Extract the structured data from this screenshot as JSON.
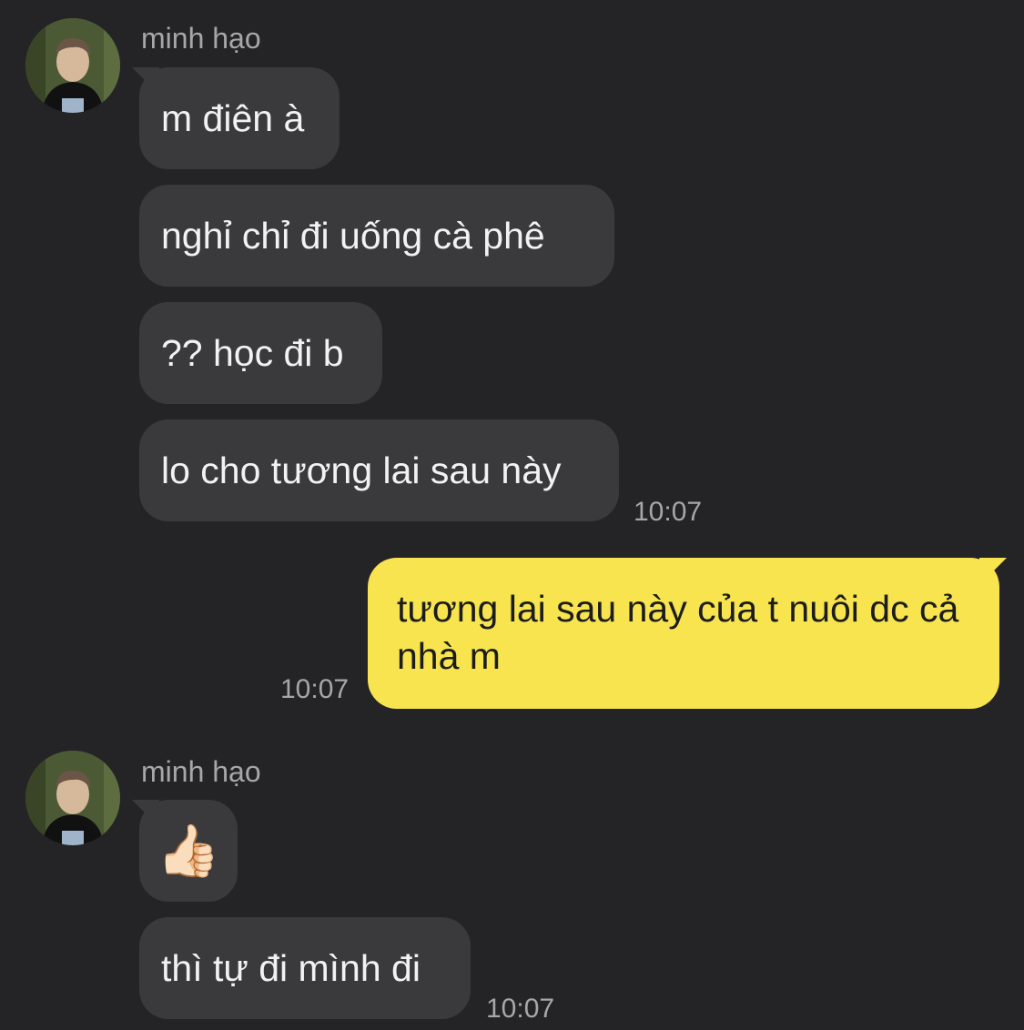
{
  "colors": {
    "background": "#242426",
    "incoming_bubble": "#3a3a3d",
    "outgoing_bubble": "#f7e44e",
    "timestamp": "#a7a7aa"
  },
  "groups": [
    {
      "sender": "minh hạo",
      "messages": [
        "m điên à",
        "nghỉ chỉ đi uống cà phê",
        "?? học đi b",
        "lo cho tương lai sau này"
      ],
      "time": "10:07"
    },
    {
      "outgoing": "tương lai sau này của t nuôi dc cả nhà m",
      "time": "10:07"
    },
    {
      "sender": "minh hạo",
      "messages": [
        "👍🏻",
        "thì tự đi mình đi"
      ],
      "time": "10:07"
    }
  ]
}
